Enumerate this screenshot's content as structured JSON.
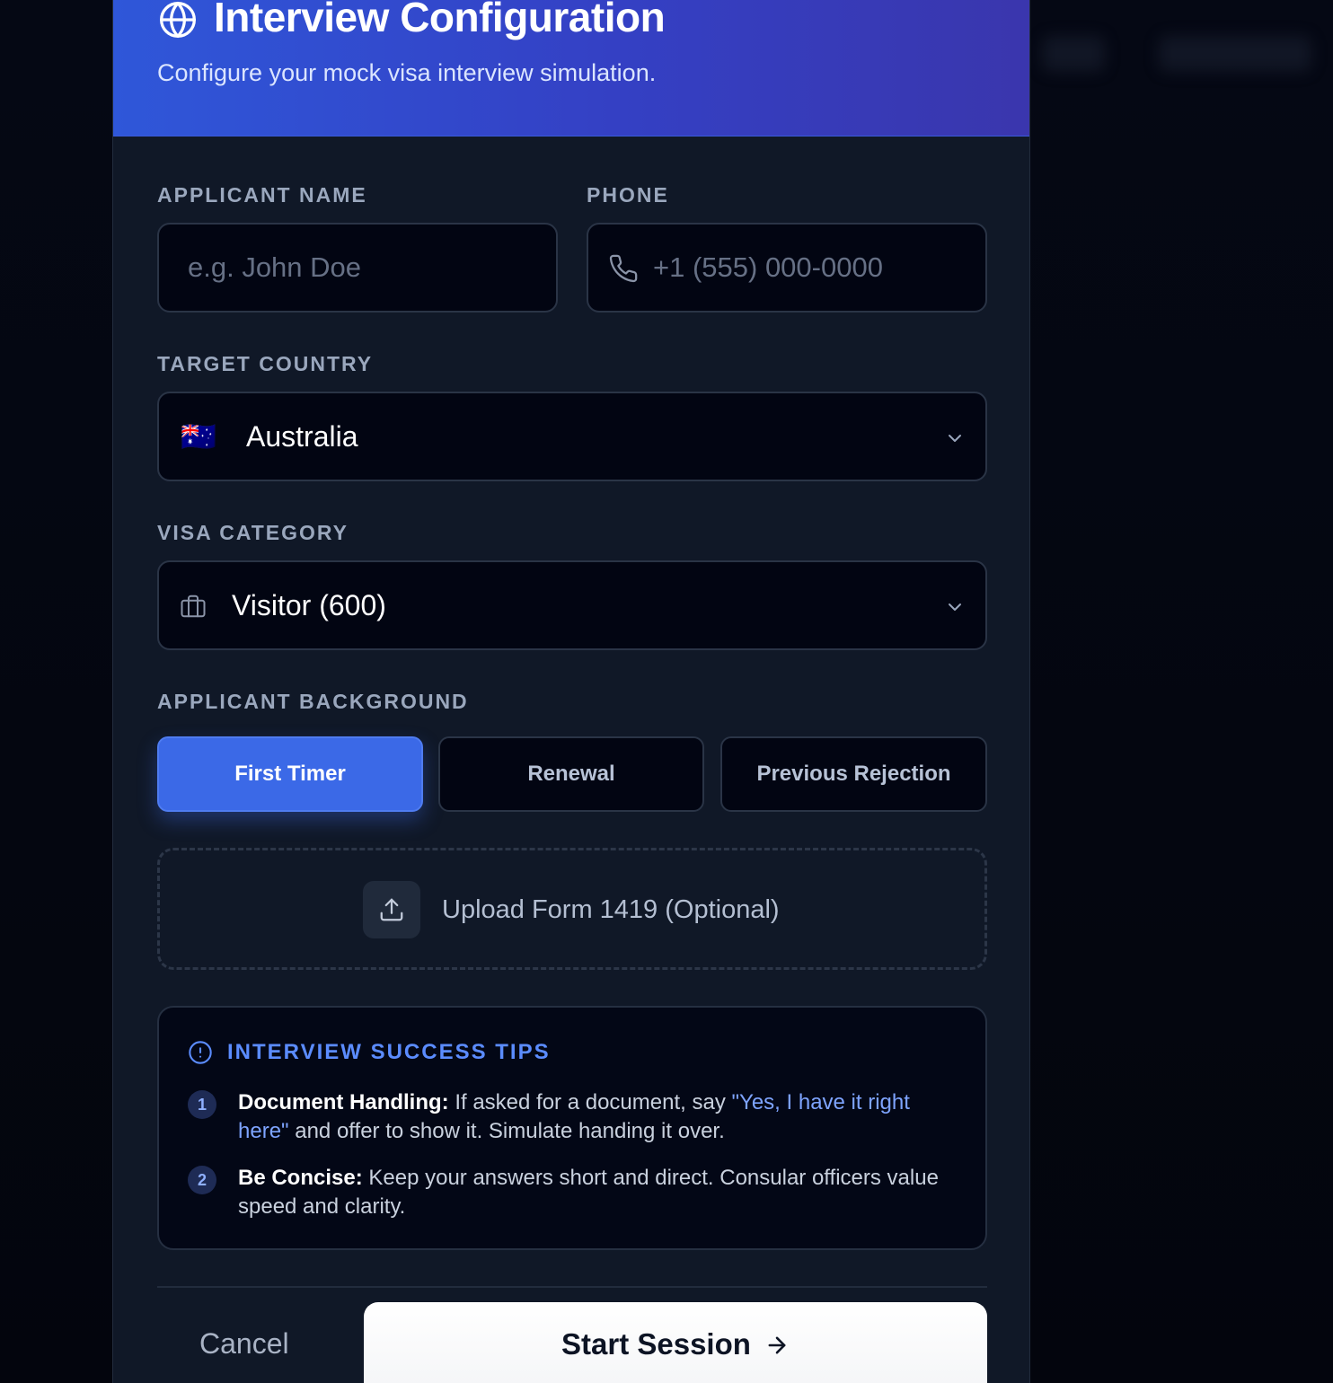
{
  "header": {
    "title": "Interview Configuration",
    "subtitle": "Configure your mock visa interview simulation."
  },
  "form": {
    "applicant_name": {
      "label": "APPLICANT NAME",
      "placeholder": "e.g. John Doe",
      "value": ""
    },
    "phone": {
      "label": "PHONE",
      "placeholder": "+1 (555) 000-0000",
      "value": ""
    },
    "target_country": {
      "label": "TARGET COUNTRY",
      "flag": "🇦🇺",
      "value": "Australia"
    },
    "visa_category": {
      "label": "VISA CATEGORY",
      "value": "Visitor (600)"
    },
    "background": {
      "label": "APPLICANT BACKGROUND",
      "options": [
        "First Timer",
        "Renewal",
        "Previous Rejection"
      ],
      "selected": "First Timer"
    },
    "upload_label": "Upload Form 1419 (Optional)"
  },
  "tips": {
    "title": "INTERVIEW SUCCESS TIPS",
    "items": [
      {
        "num": "1",
        "heading": "Document Handling:",
        "text_before": "If asked for a document, say",
        "quote": "\"Yes, I have it right here\"",
        "text_after": "and offer to show it. Simulate handing it over."
      },
      {
        "num": "2",
        "heading": "Be Concise:",
        "text": "Keep your answers short and direct. Consular officers value speed and clarity."
      }
    ]
  },
  "actions": {
    "cancel_label": "Cancel",
    "start_label": "Start Session"
  },
  "colors": {
    "accent": "#3b69e7",
    "header_gradient_start": "#2f57d9",
    "header_gradient_end": "#3a36ad",
    "tip_highlight": "#7ea4ff"
  },
  "icons": {
    "header": "globe-icon",
    "phone": "phone-icon",
    "visa": "briefcase-icon",
    "upload": "upload-icon",
    "tips": "info-circle-icon",
    "start": "arrow-right-icon"
  }
}
